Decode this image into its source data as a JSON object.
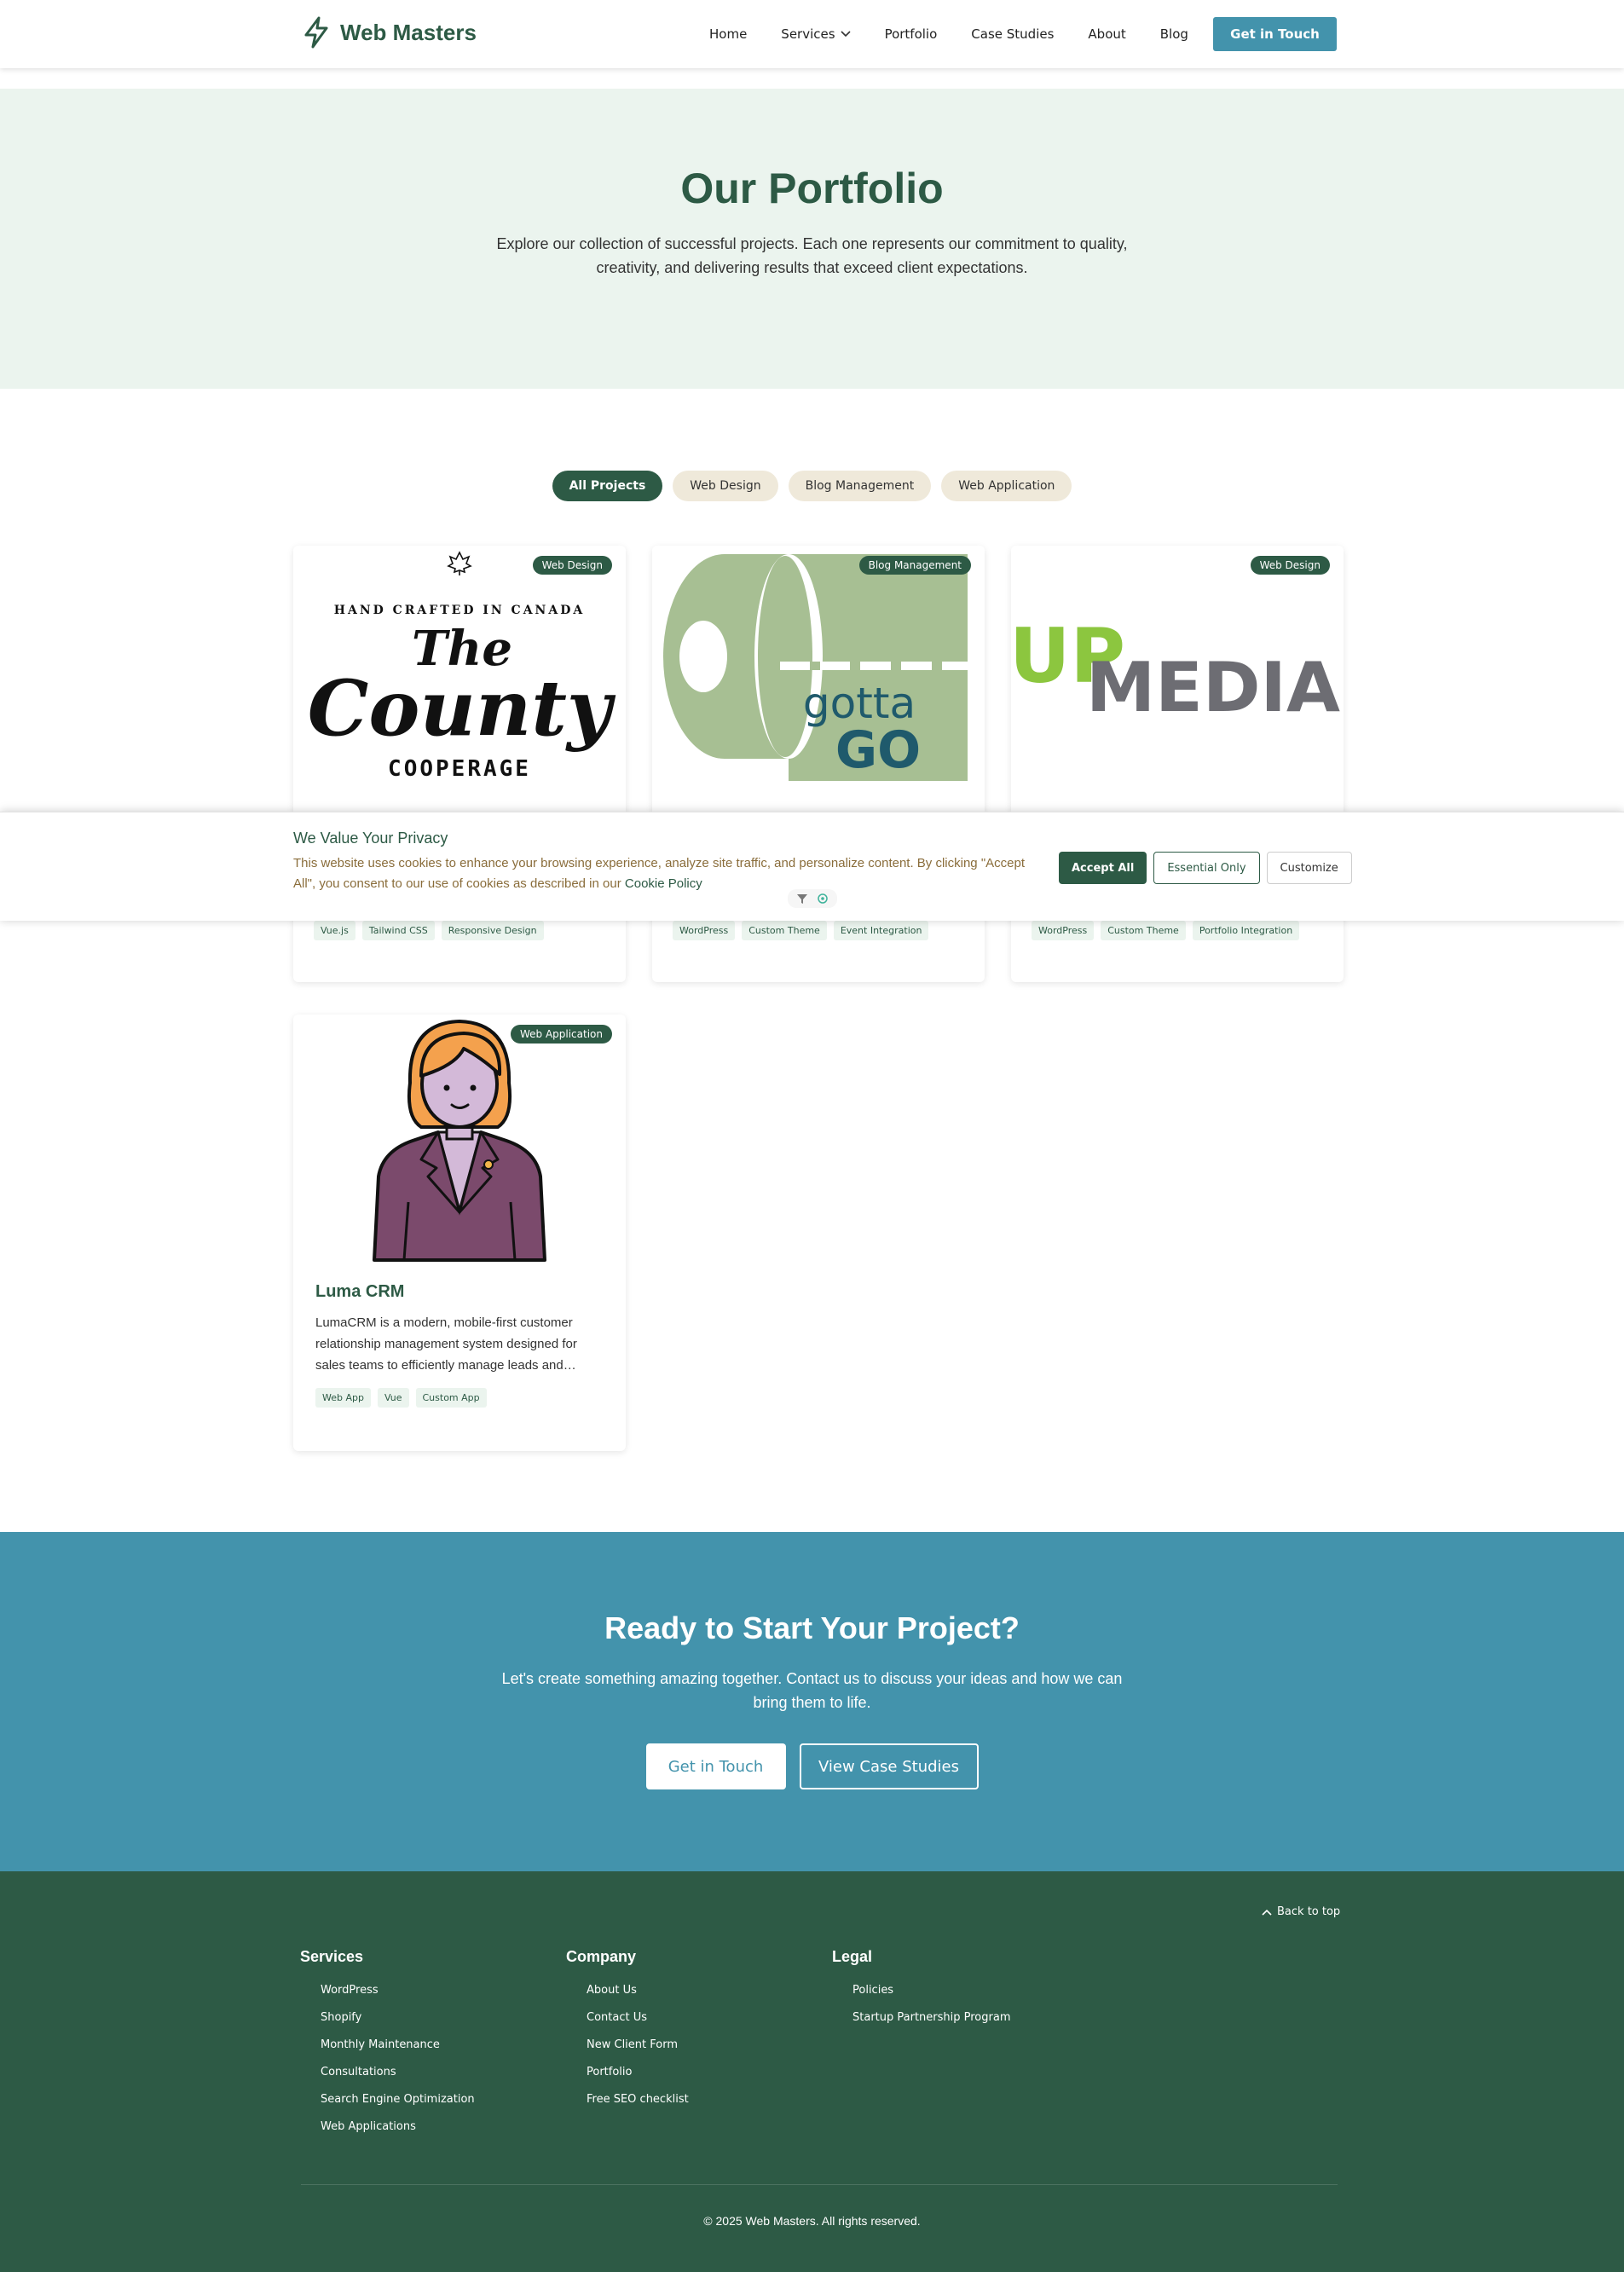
{
  "header": {
    "brand": "Web Masters",
    "nav": [
      {
        "label": "Home"
      },
      {
        "label": "Services"
      },
      {
        "label": "Portfolio"
      },
      {
        "label": "Case Studies"
      },
      {
        "label": "About"
      },
      {
        "label": "Blog"
      }
    ],
    "cta": "Get in Touch"
  },
  "hero": {
    "title": "Our Portfolio",
    "description": "Explore our collection of successful projects. Each one represents our commitment to quality, creativity, and delivering results that exceed client expectations."
  },
  "filters": [
    "All Projects",
    "Web Design",
    "Blog Management",
    "Web Application"
  ],
  "projects": [
    {
      "badge": "Web Design",
      "logo_text": {
        "line1": "HAND CRAFTED IN CANADA",
        "line2": "The",
        "line3": "County",
        "line4": "COOPERAGE"
      },
      "tags": [
        "Vue.js",
        "Tailwind CSS",
        "Responsive Design"
      ]
    },
    {
      "badge": "Blog Management",
      "logo_text": {
        "line1": "gotta",
        "line2": "GO"
      },
      "tags": [
        "WordPress",
        "Custom Theme",
        "Event Integration"
      ]
    },
    {
      "badge": "Web Design",
      "logo_text": {
        "line1": "UP",
        "line2": "MEDIA"
      },
      "tags": [
        "WordPress",
        "Custom Theme",
        "Portfolio Integration"
      ]
    },
    {
      "badge": "Web Application",
      "title": "Luma CRM",
      "description": "LumaCRM is a modern, mobile-first customer relationship management system designed for sales teams to efficiently manage leads and…",
      "tags": [
        "Web App",
        "Vue",
        "Custom App"
      ]
    }
  ],
  "cookie": {
    "title": "We Value Your Privacy",
    "text": "This website uses cookies to enhance your browsing experience, analyze site traffic, and personalize content. By clicking \"Accept All\", you consent to our use of cookies as described in our",
    "link": "Cookie Policy",
    "accept": "Accept All",
    "essential": "Essential Only",
    "customize": "Customize"
  },
  "cta": {
    "title": "Ready to Start Your Project?",
    "text": "Let's create something amazing together. Contact us to discuss your ideas and how we can bring them to life.",
    "primary": "Get in Touch",
    "secondary": "View Case Studies"
  },
  "footer": {
    "back_to_top": "Back to top",
    "columns": [
      {
        "title": "Services",
        "links": [
          "WordPress",
          "Shopify",
          "Monthly Maintenance",
          "Consultations",
          "Search Engine Optimization",
          "Web Applications"
        ]
      },
      {
        "title": "Company",
        "links": [
          "About Us",
          "Contact Us",
          "New Client Form",
          "Portfolio",
          "Free SEO checklist"
        ]
      },
      {
        "title": "Legal",
        "links": [
          "Policies",
          "Startup Partnership Program"
        ]
      }
    ],
    "copyright": "© 2025 Web Masters. All rights reserved."
  },
  "colors": {
    "primary": "#2d5a45",
    "accent": "#4393ac",
    "hero_bg": "#ebf4ee",
    "filter_bg": "#efe9da",
    "cookie_text": "#8a6d3b"
  }
}
